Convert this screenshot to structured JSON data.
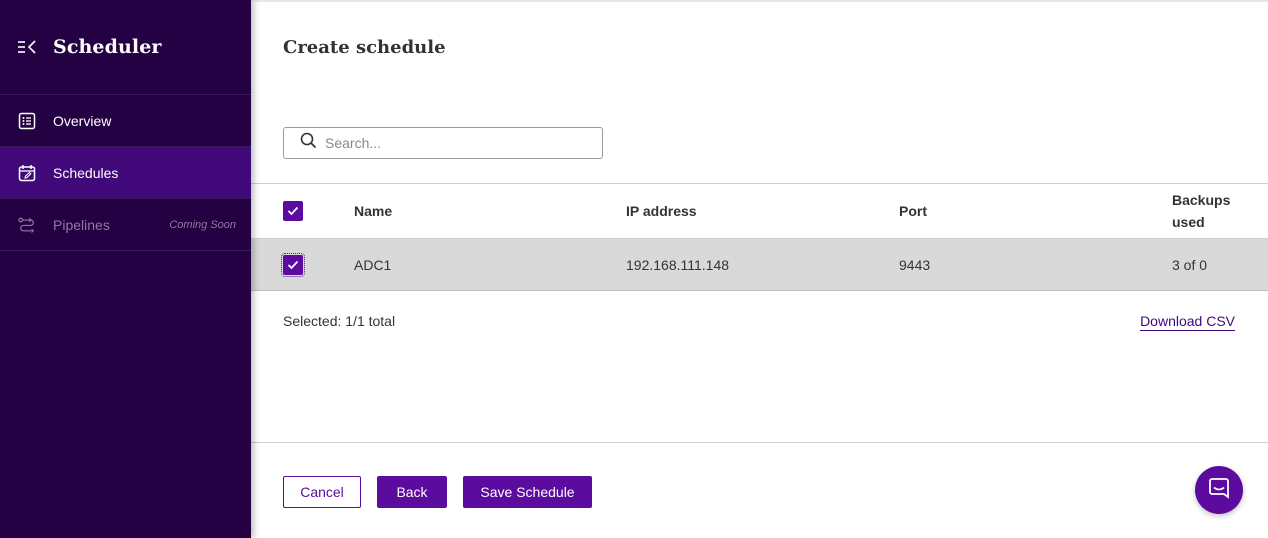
{
  "sidebar": {
    "title": "Scheduler",
    "items": [
      {
        "label": "Overview",
        "icon": "list-icon",
        "state": "normal"
      },
      {
        "label": "Schedules",
        "icon": "calendar-edit-icon",
        "state": "active"
      },
      {
        "label": "Pipelines",
        "icon": "pipeline-icon",
        "state": "disabled",
        "badge": "Coming Soon"
      }
    ]
  },
  "main": {
    "title": "Create schedule",
    "search": {
      "placeholder": "Search...",
      "value": ""
    },
    "table": {
      "columns": [
        "Name",
        "IP address",
        "Port",
        "Backups used"
      ],
      "header_checked": true,
      "rows": [
        {
          "checked": true,
          "name": "ADC1",
          "ip": "192.168.111.148",
          "port": "9443",
          "backups": "3 of 0"
        }
      ]
    },
    "selected_info": "Selected: 1/1 total",
    "download_label": "Download CSV",
    "buttons": {
      "cancel": "Cancel",
      "back": "Back",
      "save": "Save Schedule"
    }
  },
  "colors": {
    "sidebar_bg": "#240142",
    "active_item": "#41087a",
    "accent": "#5b0c9e",
    "row_selected": "#d9d9d9"
  }
}
